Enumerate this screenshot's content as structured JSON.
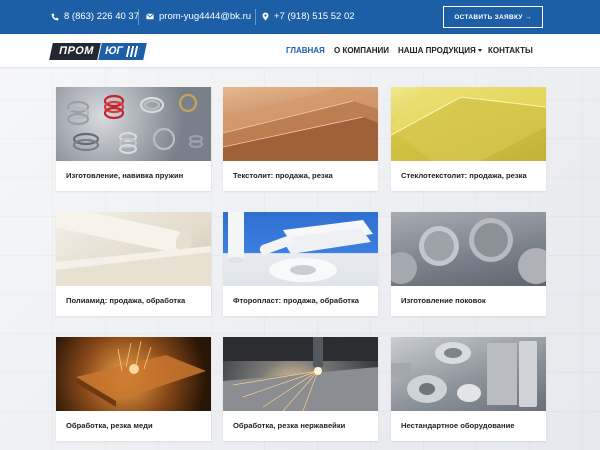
{
  "topbar": {
    "phone_1": "8 (863) 226 40 37",
    "email": "prom-yug4444@bk.ru",
    "phone_2": "+7 (918) 515 52 02",
    "cta_label": "ОСТАВИТЬ ЗАЯВКУ →"
  },
  "logo": {
    "part_1": "ПРОМ",
    "part_2": "ЮГ"
  },
  "nav": {
    "home": "ГЛАВНАЯ",
    "about": "О КОМПАНИИ",
    "products": "НАША ПРОДУКЦИЯ",
    "contacts": "КОНТАКТЫ"
  },
  "colors": {
    "brand_blue": "#1d5fa6",
    "logo_dark": "#222831"
  },
  "cards": [
    {
      "title": "Изготовление, навивка пружин",
      "image": "springs-photo"
    },
    {
      "title": "Текстолит: продажа, резка",
      "image": "textolite-sheets-photo"
    },
    {
      "title": "Стеклотекстолит: продажа, резка",
      "image": "fiberglass-sheets-photo"
    },
    {
      "title": "Полиамид: продажа, обработка",
      "image": "polyamide-rods-photo"
    },
    {
      "title": "Фторопласт: продажа, обработка",
      "image": "ptfe-parts-photo"
    },
    {
      "title": "Изготовление поковок",
      "image": "forgings-photo"
    },
    {
      "title": "Обработка, резка меди",
      "image": "copper-cutting-photo"
    },
    {
      "title": "Обработка, резка нержавейки",
      "image": "steel-cutting-photo"
    },
    {
      "title": "Нестандартное оборудование",
      "image": "custom-equipment-photo"
    }
  ]
}
